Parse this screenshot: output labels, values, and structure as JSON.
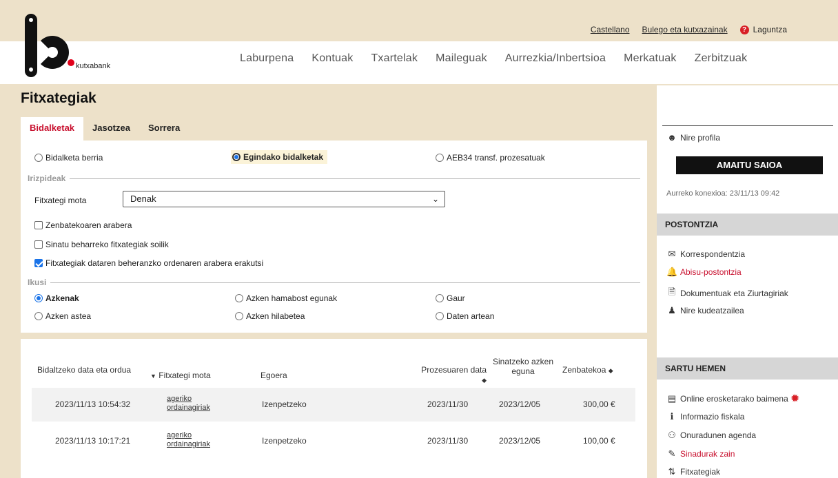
{
  "header": {
    "brand": "kutxabank",
    "util": {
      "lang": "Castellano",
      "offices": "Bulego eta kutxazainak",
      "help": "Laguntza"
    },
    "nav": [
      "Laburpena",
      "Kontuak",
      "Txartelak",
      "Maileguak",
      "Aurrezkia/Inbertsioa",
      "Merkatuak",
      "Zerbitzuak"
    ]
  },
  "main": {
    "title": "Fitxategiak",
    "tabs": [
      "Bidalketak",
      "Jasotzea",
      "Sorrera"
    ],
    "send_options": [
      "Bidalketa berria",
      "Egindako bidalketak",
      "AEB34 transf. prozesatuak"
    ],
    "criteria_label": "Irizpideak",
    "file_type_label": "Fitxategi mota",
    "file_type_value": "Denak",
    "checkboxes": [
      "Zenbatekoaren arabera",
      "Sinatu beharreko fitxategiak soilik",
      "Fitxategiak dataren beheranzko ordenaren arabera erakutsi"
    ],
    "view_label": "Ikusi",
    "view_options": [
      "Azkenak",
      "Azken hamabost egunak",
      "Gaur",
      "Azken astea",
      "Azken hilabetea",
      "Daten artean"
    ]
  },
  "table": {
    "headers": {
      "send_date": "Bidaltzeko data eta ordua",
      "file_type": "Fitxategi mota",
      "status": "Egoera",
      "process_date": "Prozesuaren data",
      "sign_deadline": "Sinatzeko azken eguna",
      "amount": "Zenbatekoa"
    },
    "rows": [
      {
        "send_date": "2023/11/13 10:54:32",
        "type_line1": "ageriko",
        "type_line2": "ordainagiriak",
        "status": "Izenpetzeko",
        "process_date": "2023/11/30",
        "sign_deadline": "2023/12/05",
        "amount": "300,00 €"
      },
      {
        "send_date": "2023/11/13 10:17:21",
        "type_line1": "ageriko",
        "type_line2": "ordainagiriak",
        "status": "Izenpetzeko",
        "process_date": "2023/11/30",
        "sign_deadline": "2023/12/05",
        "amount": "100,00 €"
      }
    ]
  },
  "sidebar": {
    "profile": "Nire profila",
    "logout": "AMAITU SAIOA",
    "last_connection": "Aurreko konexioa: 23/11/13 09:42",
    "mailbox_title": "POSTONTZIA",
    "mailbox_items": [
      "Korrespondentzia",
      "Abisu-postontzia",
      "Dokumentuak eta Ziurtagiriak",
      "Nire kudeatzailea"
    ],
    "enter_title": "SARTU HEMEN",
    "enter_items": [
      "Online erosketarako baimena",
      "Informazio fiskala",
      "Onuradunen agenda",
      "Sinadurak zain",
      "Fitxategiak"
    ]
  },
  "colors": {
    "accent_red": "#c8102e",
    "page_bg": "#ede1c9",
    "select_blue": "#1a73e8"
  }
}
